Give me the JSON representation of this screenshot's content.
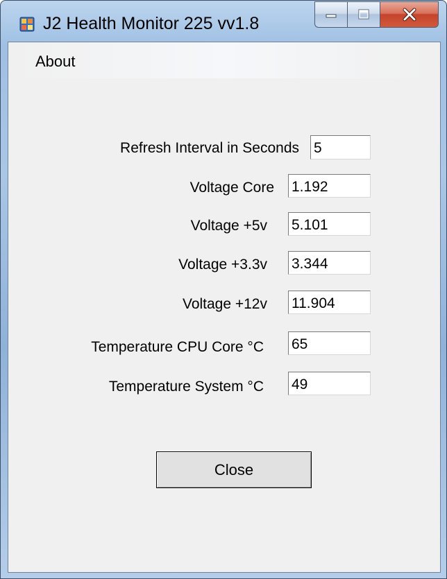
{
  "window": {
    "title": "J2 Health Monitor 225 vv1.8",
    "icon": "application-window-icon"
  },
  "caption_buttons": {
    "minimize": "minimize-icon",
    "maximize": "maximize-icon",
    "close": "close-x-icon"
  },
  "menu": {
    "items": [
      "About"
    ]
  },
  "form": {
    "refresh_interval": {
      "label": "Refresh Interval in Seconds",
      "value": "5"
    },
    "voltage_core": {
      "label": "Voltage Core",
      "value": "1.192"
    },
    "voltage_5v": {
      "label": "Voltage +5v",
      "value": "5.101"
    },
    "voltage_3_3v": {
      "label": "Voltage +3.3v",
      "value": "3.344"
    },
    "voltage_12v": {
      "label": "Voltage +12v",
      "value": "11.904"
    },
    "temp_cpu": {
      "label": "Temperature CPU Core  °C",
      "value": "65"
    },
    "temp_system": {
      "label": "Temperature System  °C",
      "value": "49"
    }
  },
  "buttons": {
    "close_label": "Close"
  }
}
